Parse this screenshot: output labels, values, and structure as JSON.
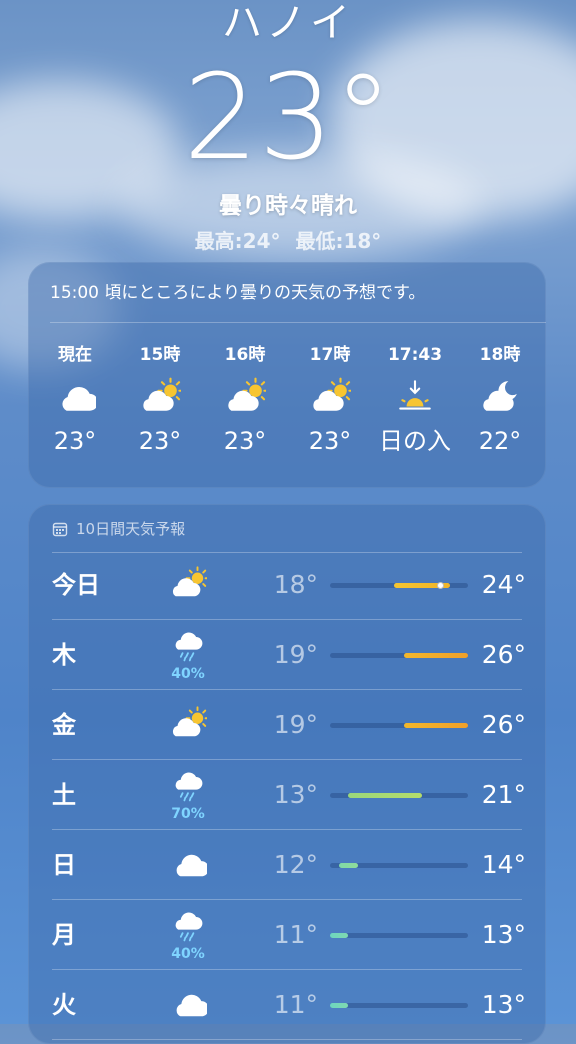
{
  "header": {
    "city": "ハノイ",
    "temperature": "23°",
    "condition": "曇り時々晴れ",
    "hilo": "最高:24° 最低:18°"
  },
  "hourly": {
    "summary": "15:00 頃にところにより曇りの天気の予想です。",
    "items": [
      {
        "label": "現在",
        "icon": "cloud-icon",
        "value": "23°"
      },
      {
        "label": "15時",
        "icon": "partly-sunny-icon",
        "value": "23°"
      },
      {
        "label": "16時",
        "icon": "partly-sunny-icon",
        "value": "23°"
      },
      {
        "label": "17時",
        "icon": "partly-sunny-icon",
        "value": "23°"
      },
      {
        "label": "17:43",
        "icon": "sunset-icon",
        "value": "日の入"
      },
      {
        "label": "18時",
        "icon": "partly-cloudy-night-icon",
        "value": "22°"
      }
    ]
  },
  "daily": {
    "title": "10日間天気予報",
    "range_min": 11,
    "range_max": 26,
    "days": [
      {
        "day": "今日",
        "icon": "partly-sunny-icon",
        "precip": "",
        "low": "18°",
        "high": "24°",
        "low_v": 18,
        "high_v": 24,
        "current_v": 23,
        "color_a": "#f5c531",
        "color_b": "#f0b429"
      },
      {
        "day": "木",
        "icon": "rain-cloud-icon",
        "precip": "40%",
        "low": "19°",
        "high": "26°",
        "low_v": 19,
        "high_v": 26,
        "color_a": "#f2b72c",
        "color_b": "#f0a02a"
      },
      {
        "day": "金",
        "icon": "partly-sunny-icon",
        "precip": "",
        "low": "19°",
        "high": "26°",
        "low_v": 19,
        "high_v": 26,
        "color_a": "#f2b72c",
        "color_b": "#f0a02a"
      },
      {
        "day": "土",
        "icon": "rain-cloud-icon",
        "precip": "70%",
        "low": "13°",
        "high": "21°",
        "low_v": 13,
        "high_v": 21,
        "color_a": "#9ad77a",
        "color_b": "#b5dc6a"
      },
      {
        "day": "日",
        "icon": "cloud-icon",
        "precip": "",
        "low": "12°",
        "high": "14°",
        "low_v": 12,
        "high_v": 14,
        "color_a": "#7fd9a8",
        "color_b": "#8fdc9a"
      },
      {
        "day": "月",
        "icon": "rain-cloud-icon",
        "precip": "40%",
        "low": "11°",
        "high": "13°",
        "low_v": 11,
        "high_v": 13,
        "color_a": "#6dd6c0",
        "color_b": "#7fd9b0"
      },
      {
        "day": "火",
        "icon": "cloud-icon",
        "precip": "",
        "low": "11°",
        "high": "13°",
        "low_v": 11,
        "high_v": 13,
        "color_a": "#6dd6c0",
        "color_b": "#7fd9b0"
      }
    ]
  }
}
